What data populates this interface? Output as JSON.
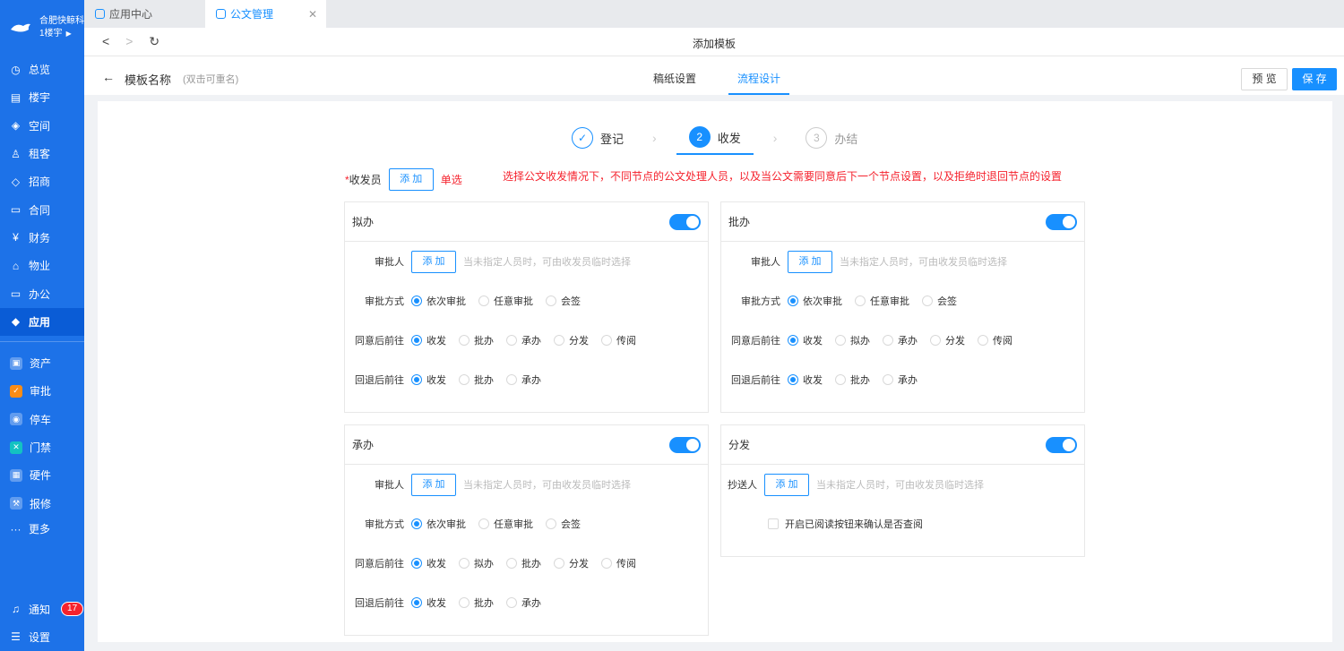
{
  "sidebar": {
    "logo_line1": "合肥快鲸科",
    "logo_line2": "1楼宇",
    "items": [
      {
        "label": "总览",
        "icon": "dashboard-icon"
      },
      {
        "label": "楼宇",
        "icon": "building-icon"
      },
      {
        "label": "空间",
        "icon": "cube-icon"
      },
      {
        "label": "租客",
        "icon": "users-icon"
      },
      {
        "label": "招商",
        "icon": "tag-icon"
      },
      {
        "label": "合同",
        "icon": "document-icon"
      },
      {
        "label": "财务",
        "icon": "yen-icon"
      },
      {
        "label": "物业",
        "icon": "home-icon"
      },
      {
        "label": "办公",
        "icon": "monitor-icon"
      },
      {
        "label": "应用",
        "icon": "app-icon"
      }
    ],
    "apps": [
      {
        "label": "资产",
        "icon": "asset-icon"
      },
      {
        "label": "审批",
        "icon": "approval-icon"
      },
      {
        "label": "停车",
        "icon": "parking-icon"
      },
      {
        "label": "门禁",
        "icon": "access-icon"
      },
      {
        "label": "硬件",
        "icon": "hardware-icon"
      },
      {
        "label": "报修",
        "icon": "repair-icon"
      }
    ],
    "more": "更多",
    "notify_label": "通知",
    "notify_count": "17",
    "settings_label": "设置"
  },
  "tabs": [
    {
      "label": "应用中心"
    },
    {
      "label": "公文管理"
    }
  ],
  "page_title": "添加模板",
  "header": {
    "template_name": "模板名称",
    "template_hint": "(双击可重名)",
    "tab_paper": "稿纸设置",
    "tab_flow": "流程设计",
    "preview": "预 览",
    "save": "保 存"
  },
  "steps": [
    {
      "label": "登记",
      "num": "✓"
    },
    {
      "label": "收发",
      "num": "2"
    },
    {
      "label": "办结",
      "num": "3"
    }
  ],
  "issuer": {
    "req": "*",
    "label": "收发员",
    "add": "添 加",
    "single": "单选"
  },
  "notice": "选择公文收发情况下，不同节点的公文处理人员，以及当公文需要同意后下一个节点设置，以及拒绝时退回节点的设置",
  "labels": {
    "approver": "审批人",
    "add": "添 加",
    "approver_hint": "当未指定人员时，可由收发员临时选择",
    "mode": "审批方式",
    "agree": "同意后前往",
    "back": "回退后前往",
    "cc": "抄送人",
    "read_confirm": "开启已阅读按钮来确认是否查阅"
  },
  "modes": [
    "依次审批",
    "任意审批",
    "会签"
  ],
  "cards": {
    "draft": {
      "title": "拟办",
      "agree": [
        "收发",
        "批办",
        "承办",
        "分发",
        "传阅"
      ],
      "back": [
        "收发",
        "批办",
        "承办"
      ]
    },
    "approve": {
      "title": "批办",
      "agree": [
        "收发",
        "拟办",
        "承办",
        "分发",
        "传阅"
      ],
      "back": [
        "收发",
        "批办",
        "承办"
      ]
    },
    "handle": {
      "title": "承办",
      "agree": [
        "收发",
        "拟办",
        "批办",
        "分发",
        "传阅"
      ],
      "back": [
        "收发",
        "批办",
        "承办"
      ]
    },
    "distribute": {
      "title": "分发"
    }
  }
}
